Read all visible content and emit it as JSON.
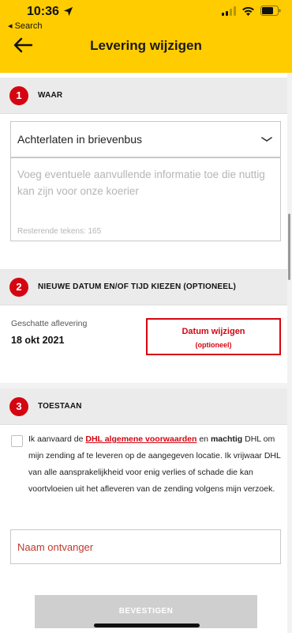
{
  "status_bar": {
    "time": "10:36",
    "back_app": "◂ Search"
  },
  "header": {
    "title": "Levering wijzigen"
  },
  "sections": [
    {
      "number": "1",
      "title": "WAAR"
    },
    {
      "number": "2",
      "title": "NIEUWE DATUM EN/OF TIJD KIEZEN (OPTIONEEL)"
    },
    {
      "number": "3",
      "title": "TOESTAAN"
    }
  ],
  "location": {
    "selected_option": "Achterlaten in brievenbus",
    "notes_placeholder": "Voeg eventuele aanvullende informatie toe die nuttig kan zijn voor onze koerier",
    "remaining_chars": "Resterende tekens: 165"
  },
  "delivery": {
    "estimate_label": "Geschatte aflevering",
    "estimate_date": "18 okt 2021",
    "change_button": "Datum wijzigen",
    "change_button_sub": "(optioneel)"
  },
  "consent": {
    "text_1": "Ik aanvaard de ",
    "link": "DHL algemene voorwaarden",
    "text_2": " en ",
    "bold": "machtig",
    "text_3": " DHL om mijn zending af te leveren op de aangegeven locatie. Ik vrijwaar DHL van alle aansprakelijkheid voor enig verlies of schade die kan voortvloeien uit het afleveren van de zending volgens mijn verzoek."
  },
  "recipient": {
    "placeholder": "Naam ontvanger"
  },
  "confirm_button": "BEVESTIGEN",
  "colors": {
    "brand_yellow": "#FFCC00",
    "brand_red": "#D40511",
    "disabled_gray": "#cfcfcf"
  },
  "icons": [
    "location-arrow-icon",
    "signal-icon",
    "wifi-icon",
    "battery-icon",
    "back-arrow-icon",
    "chevron-down-icon"
  ]
}
